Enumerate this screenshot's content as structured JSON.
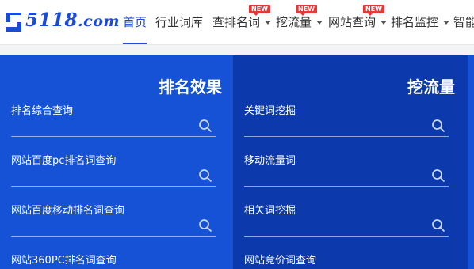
{
  "logo": {
    "text": "5118",
    "suffix": ".com"
  },
  "nav": {
    "items": [
      {
        "label": "首页",
        "active": true,
        "caret": false,
        "badge": ""
      },
      {
        "label": "行业词库",
        "active": false,
        "caret": false,
        "badge": ""
      },
      {
        "label": "查排名词",
        "active": false,
        "caret": true,
        "badge": "NEW"
      },
      {
        "label": "挖流量",
        "active": false,
        "caret": true,
        "badge": "NEW"
      },
      {
        "label": "网站查询",
        "active": false,
        "caret": true,
        "badge": "NEW"
      },
      {
        "label": "排名监控",
        "active": false,
        "caret": true,
        "badge": ""
      },
      {
        "label": "智能",
        "active": false,
        "caret": false,
        "badge": ""
      }
    ]
  },
  "panels": {
    "left": {
      "title": "排名效果",
      "items": [
        {
          "label": "排名综合查询",
          "value": "",
          "placeholder": ""
        },
        {
          "label": "网站百度pc排名词查询",
          "value": "",
          "placeholder": ""
        },
        {
          "label": "网站百度移动排名词查询",
          "value": "",
          "placeholder": ""
        },
        {
          "label": "网站360PC排名词查询",
          "value": "",
          "placeholder": ""
        }
      ]
    },
    "right": {
      "title": "挖流量",
      "items": [
        {
          "label": "关键词挖掘",
          "value": "",
          "placeholder": ""
        },
        {
          "label": "移动流量词",
          "value": "",
          "placeholder": ""
        },
        {
          "label": "相关词挖掘",
          "value": "",
          "placeholder": ""
        },
        {
          "label": "网站竞价词查询",
          "value": "",
          "placeholder": ""
        }
      ]
    }
  },
  "colors": {
    "brand": "#1a4bd6",
    "panel_left_bg": "#1552d6",
    "panel_right_bg": "#0c3aac",
    "badge": "#e53935"
  },
  "icons": {
    "search": "search-icon",
    "caret": "chevron-down-icon",
    "logo": "logo-icon"
  }
}
